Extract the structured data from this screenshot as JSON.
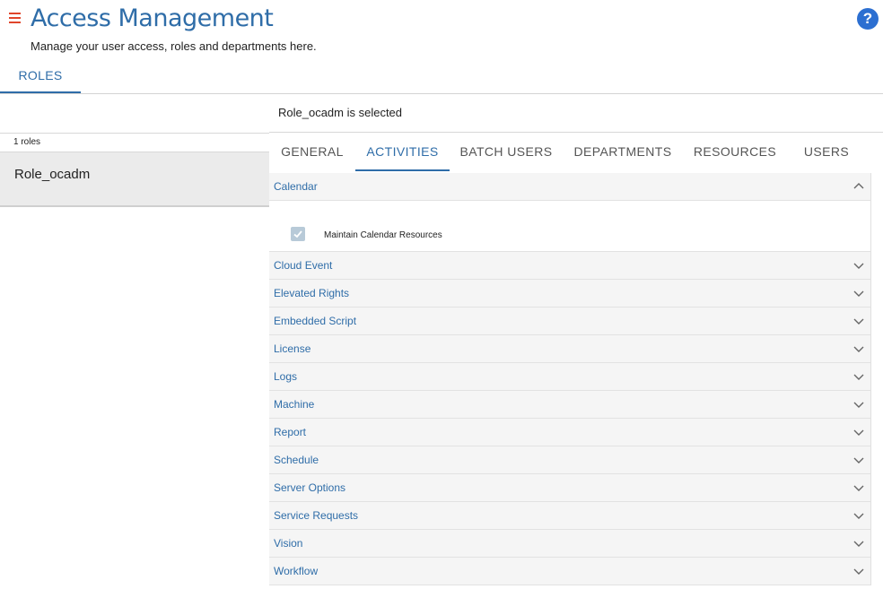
{
  "header": {
    "title": "Access Management",
    "subtitle": "Manage your user access, roles and departments here.",
    "help_label": "?"
  },
  "main_tabs": [
    {
      "label": "ROLES",
      "active": true
    }
  ],
  "roles_panel": {
    "count_label": "1 roles",
    "roles": [
      {
        "name": "Role_ocadm",
        "selected": true
      }
    ]
  },
  "detail": {
    "selected_text": "Role_ocadm is selected",
    "tabs": [
      {
        "label": "GENERAL",
        "active": false
      },
      {
        "label": "ACTIVITIES",
        "active": true
      },
      {
        "label": "BATCH USERS",
        "active": false
      },
      {
        "label": "DEPARTMENTS",
        "active": false
      },
      {
        "label": "RESOURCES",
        "active": false
      },
      {
        "label": "USERS",
        "active": false
      }
    ],
    "activities": [
      {
        "label": "Calendar",
        "expanded": true,
        "items": [
          {
            "label": "Maintain Calendar Resources",
            "checked": true
          }
        ]
      },
      {
        "label": "Cloud Event",
        "expanded": false
      },
      {
        "label": "Elevated Rights",
        "expanded": false
      },
      {
        "label": "Embedded Script",
        "expanded": false
      },
      {
        "label": "License",
        "expanded": false
      },
      {
        "label": "Logs",
        "expanded": false
      },
      {
        "label": "Machine",
        "expanded": false
      },
      {
        "label": "Report",
        "expanded": false
      },
      {
        "label": "Schedule",
        "expanded": false
      },
      {
        "label": "Server Options",
        "expanded": false
      },
      {
        "label": "Service Requests",
        "expanded": false
      },
      {
        "label": "Vision",
        "expanded": false
      },
      {
        "label": "Workflow",
        "expanded": false
      }
    ]
  },
  "colors": {
    "accent": "#2f6da8",
    "menu_icon": "#e0452b",
    "help_icon": "#2c6fd1",
    "checkbox_disabled": "#b8cad8"
  },
  "icons": {
    "menu": "hamburger-menu-icon",
    "help": "help-icon",
    "expanded": "chevron-up-icon",
    "collapsed": "chevron-down-icon",
    "check": "checkmark-icon"
  }
}
